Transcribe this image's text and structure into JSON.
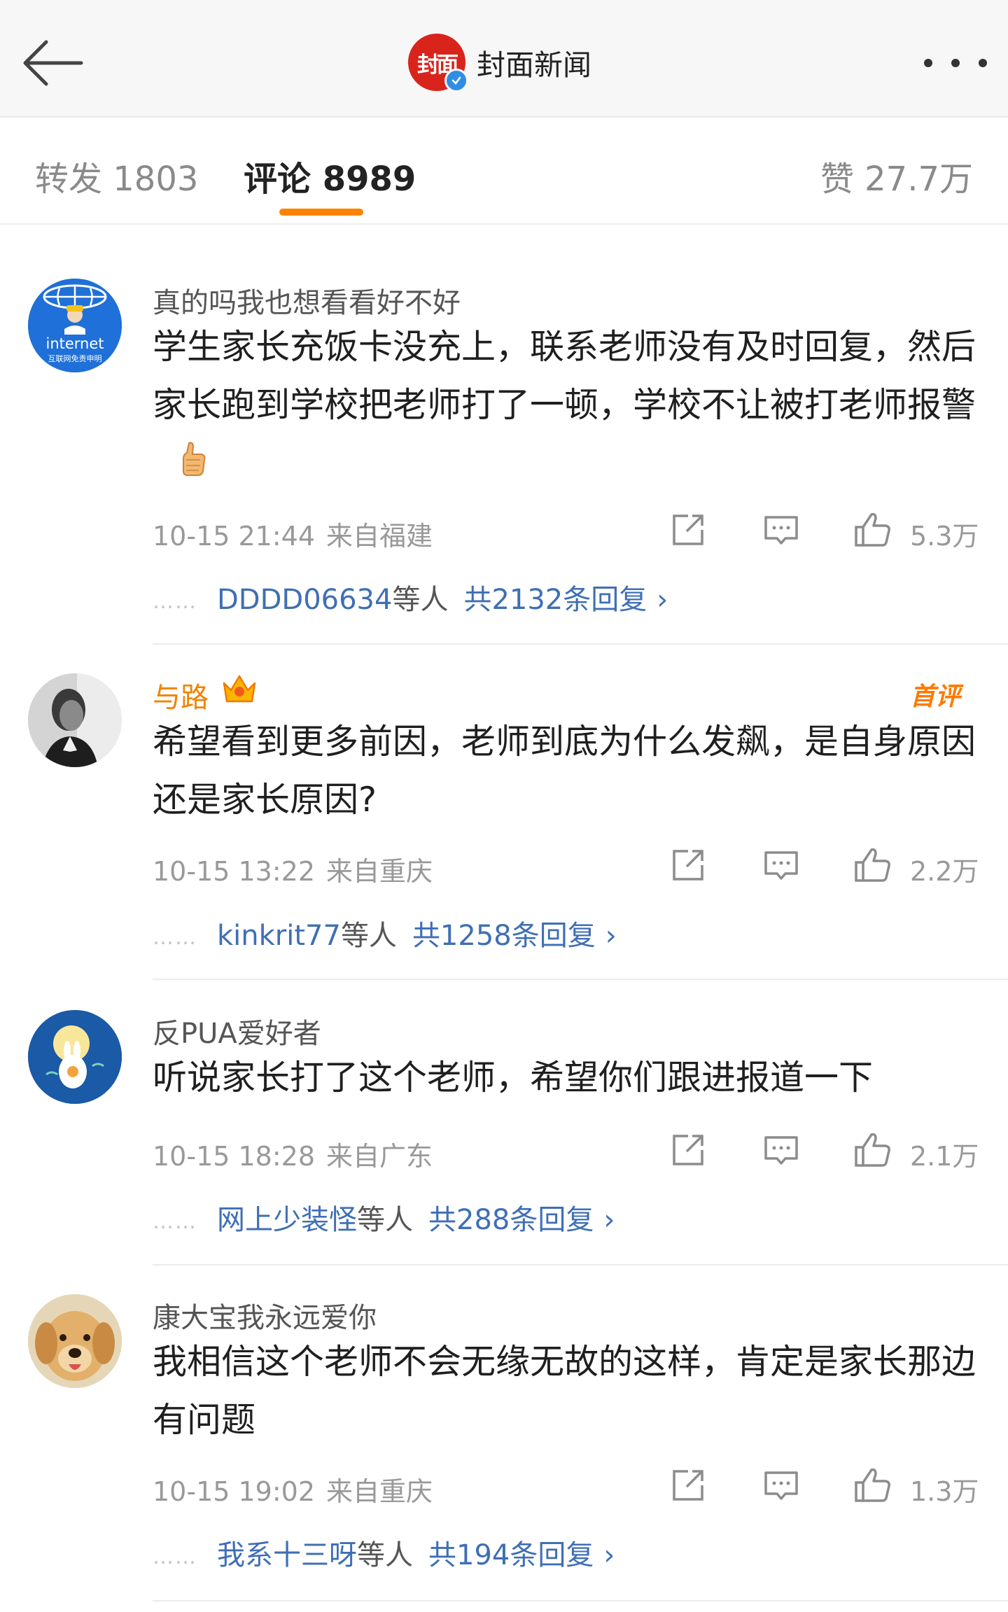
{
  "header": {
    "logo_text": "封面",
    "account_name": "封面新闻",
    "verified": true,
    "accent_color": "#d9241c"
  },
  "tabs": {
    "reposts": "转发 1803",
    "comments": "评论 8989",
    "likes": "赞 27.7万",
    "active": "comments",
    "indicator_color": "#ff8200"
  },
  "comments": [
    {
      "user": "真的吗我也想看看好不好",
      "avatar_text": "internet",
      "avatar_subtext": "互联网免责申明",
      "text": "学生家长充饭卡没充上，联系老师没有及时回复，然后家长跑到学校把老师打了一顿，学校不让被打老师报警",
      "emoji": "thumbs-up",
      "time": "10-15 21:44",
      "location": "来自福建",
      "likes": "5.3万",
      "reply_users": "DDDD06634",
      "reply_suffix": "等人",
      "reply_total": "共2132条回复"
    },
    {
      "user": "与路",
      "vip": true,
      "badge": "首评",
      "text": "希望看到更多前因，老师到底为什么发飙，是自身原因还是家长原因?",
      "time": "10-15 13:22",
      "location": "来自重庆",
      "likes": "2.2万",
      "reply_users": "kinkrit77",
      "reply_suffix": "等人",
      "reply_total": "共1258条回复"
    },
    {
      "user": "反PUA爱好者",
      "text": "听说家长打了这个老师，希望你们跟进报道一下",
      "time": "10-15 18:28",
      "location": "来自广东",
      "likes": "2.1万",
      "reply_users": "网上少装怪",
      "reply_suffix": "等人",
      "reply_total": "共288条回复"
    },
    {
      "user": "康大宝我永远爱你",
      "text": "我相信这个老师不会无缘无故的这样，肯定是家长那边有问题",
      "time": "10-15 19:02",
      "location": "来自重庆",
      "likes": "1.3万",
      "reply_users": "我系十三呀",
      "reply_suffix": "等人",
      "reply_total": "共194条回复"
    }
  ],
  "reply_dots": "……",
  "chevron": "›"
}
